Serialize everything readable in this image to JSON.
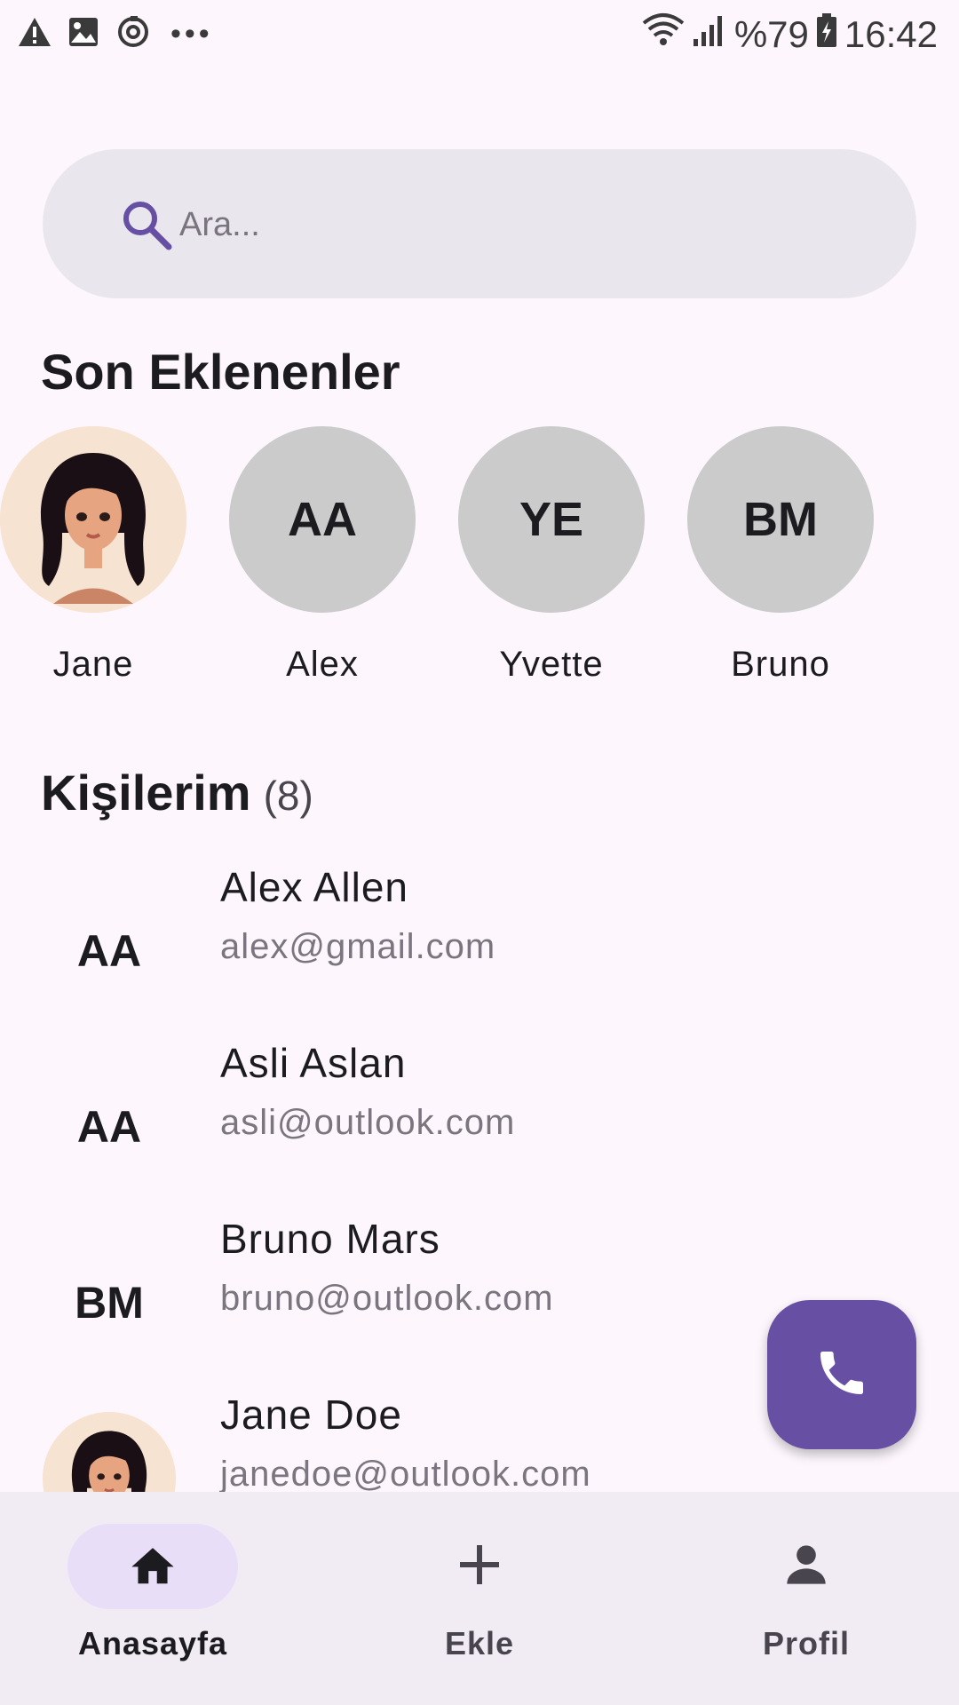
{
  "status_bar": {
    "battery": "%79",
    "time": "16:42",
    "left_icons": [
      "warning-icon",
      "image-icon",
      "sync-icon",
      "more-dots-icon"
    ],
    "right_icons": [
      "wifi-icon",
      "signal-icon",
      "battery-icon"
    ]
  },
  "search": {
    "placeholder": "Ara..."
  },
  "recent": {
    "title": "Son Eklenenler",
    "items": [
      {
        "name": "Jane",
        "initials": "",
        "photo": true
      },
      {
        "name": "Alex",
        "initials": "AA",
        "photo": false
      },
      {
        "name": "Yvette",
        "initials": "YE",
        "photo": false
      },
      {
        "name": "Bruno",
        "initials": "BM",
        "photo": false
      }
    ]
  },
  "contacts": {
    "title": "Kişilerim",
    "count": "(8)",
    "items": [
      {
        "initials": "AA",
        "name": "Alex Allen",
        "email": "alex@gmail.com",
        "photo": false
      },
      {
        "initials": "AA",
        "name": "Asli Aslan",
        "email": "asli@outlook.com",
        "photo": false
      },
      {
        "initials": "BM",
        "name": "Bruno Mars",
        "email": "bruno@outlook.com",
        "photo": false
      },
      {
        "initials": "",
        "name": "Jane Doe",
        "email": "janedoe@outlook.com",
        "photo": true
      }
    ]
  },
  "fab": {
    "icon": "phone-icon"
  },
  "bottom_nav": {
    "items": [
      {
        "label": "Anasayfa",
        "icon": "home-icon",
        "active": true
      },
      {
        "label": "Ekle",
        "icon": "plus-icon",
        "active": false
      },
      {
        "label": "Profil",
        "icon": "person-icon",
        "active": false
      }
    ]
  },
  "colors": {
    "background": "#fdf7fd",
    "accent": "#6750a4",
    "search_bg": "#e9e6ee",
    "avatar_gray": "#cbcbcb",
    "nav_bg": "#f1ecf4",
    "nav_active_pill": "#e8def8"
  }
}
